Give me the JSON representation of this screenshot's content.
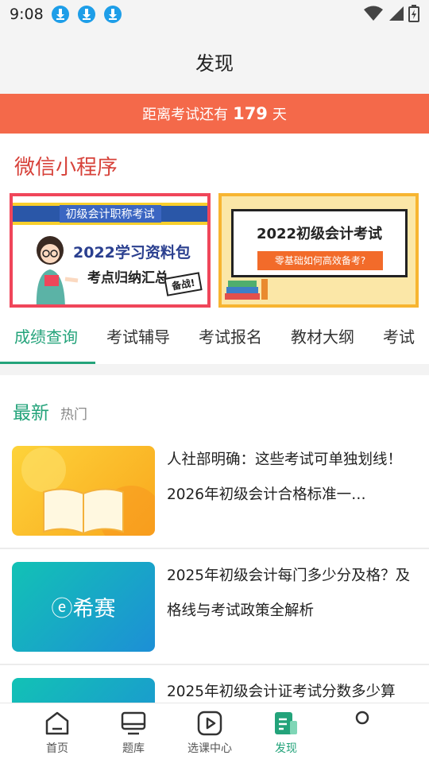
{
  "status_bar": {
    "time": "9:08",
    "icons": [
      "download-icon",
      "download-icon",
      "download-icon",
      "wifi-icon",
      "signal-icon",
      "battery-icon"
    ]
  },
  "header": {
    "title": "发现"
  },
  "countdown": {
    "prefix": "距离考试还有",
    "days": "179",
    "suffix": "天"
  },
  "mini_program": {
    "title": "微信小程序",
    "banners": [
      {
        "ribbon": "初级会计职称考试",
        "title": "2022学习资料包",
        "subtitle": "考点归纳汇总",
        "badge": "备战!"
      },
      {
        "title": "2022初级会计考试",
        "subtitle": "零基础如何高效备考?"
      }
    ]
  },
  "tabs": [
    {
      "label": "成绩查询",
      "active": true
    },
    {
      "label": "考试辅导",
      "active": false
    },
    {
      "label": "考试报名",
      "active": false
    },
    {
      "label": "教材大纲",
      "active": false
    },
    {
      "label": "考试",
      "active": false
    }
  ],
  "subtabs": {
    "latest": "最新",
    "hot": "热门"
  },
  "articles": [
    {
      "title": "人社部明确：这些考试可单独划线！2026年初级会计合格标准一…",
      "thumb": "open-book"
    },
    {
      "title": "2025年初级会计每门多少分及格？及格线与考试政策全解析",
      "thumb_text": "ⓔ希赛"
    },
    {
      "title": "2025年初级会计证考试分数多少算",
      "thumb": "teal"
    }
  ],
  "bottom_nav": [
    {
      "label": "首页",
      "icon": "home-icon",
      "active": false
    },
    {
      "label": "题库",
      "icon": "monitor-icon",
      "active": false
    },
    {
      "label": "选课中心",
      "icon": "play-icon",
      "active": false
    },
    {
      "label": "发现",
      "icon": "discover-icon",
      "active": true
    },
    {
      "label": "",
      "icon": "profile-icon",
      "active": false
    }
  ],
  "colors": {
    "accent": "#23a37a",
    "countdown_bg": "#f4694a",
    "mp_title": "#d7423a"
  }
}
